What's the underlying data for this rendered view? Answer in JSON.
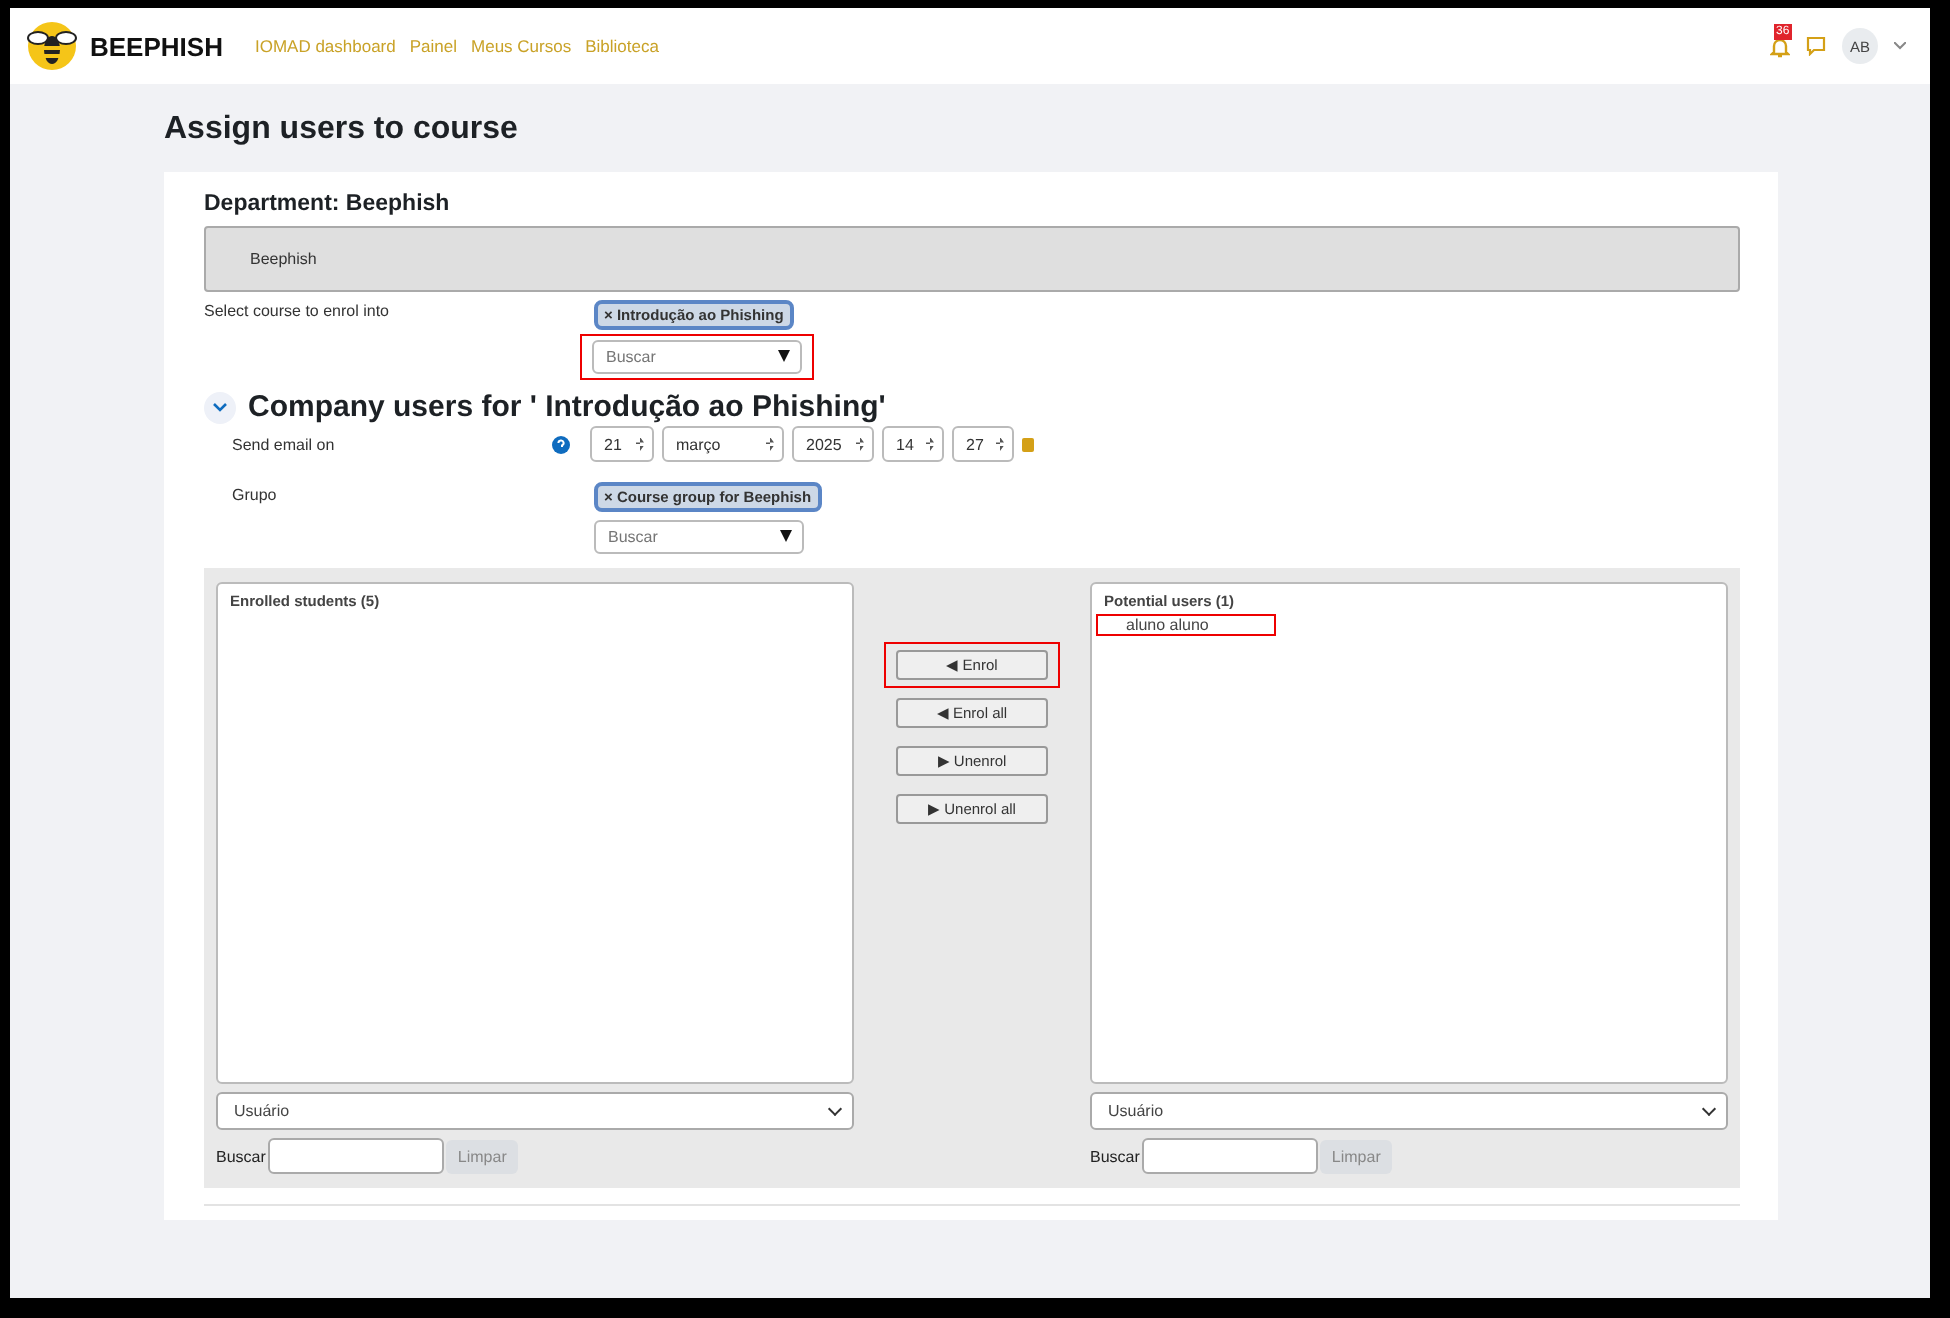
{
  "navbar": {
    "brand": "BEEPHISH",
    "links": [
      "IOMAD dashboard",
      "Painel",
      "Meus Cursos",
      "Biblioteca"
    ],
    "notification_count": "36",
    "avatar": "AB"
  },
  "page_title": "Assign users to course",
  "department": {
    "heading": "Department: Beephish",
    "value": "Beephish"
  },
  "course_select": {
    "label": "Select course to enrol into",
    "tags": [
      "× Introdução ao Phishing"
    ],
    "search": {
      "placeholder": "Buscar",
      "highlighted": true
    }
  },
  "section": {
    "title": "Company users for ' Introdução ao Phishing'",
    "expanded": true
  },
  "send_email": {
    "label": "Send email on",
    "fields": [
      "21",
      "março",
      "2025",
      "14",
      "27"
    ]
  },
  "group": {
    "label": "Grupo",
    "tags": [
      "× Course group for Beephish"
    ],
    "search": {
      "placeholder": "Buscar",
      "highlighted": false
    }
  },
  "enrolled": {
    "title": "Enrolled students (5)",
    "filter": "Usuário",
    "search_label": "Buscar",
    "clear_button": {
      "label": "Limpar",
      "disabled": true
    }
  },
  "actions": [
    {
      "label": "◀ Enrol",
      "highlighted": true
    },
    {
      "label": "◀ Enrol all",
      "highlighted": false
    },
    {
      "label": "▶ Unenrol",
      "highlighted": false
    },
    {
      "label": "▶ Unenrol all",
      "highlighted": false
    }
  ],
  "potential": {
    "title": "Potential users (1)",
    "users": [
      {
        "name": "aluno aluno",
        "highlighted": true
      }
    ],
    "filter": "Usuário",
    "search_label": "Buscar",
    "clear_button": {
      "label": "Limpar",
      "disabled": true
    }
  }
}
